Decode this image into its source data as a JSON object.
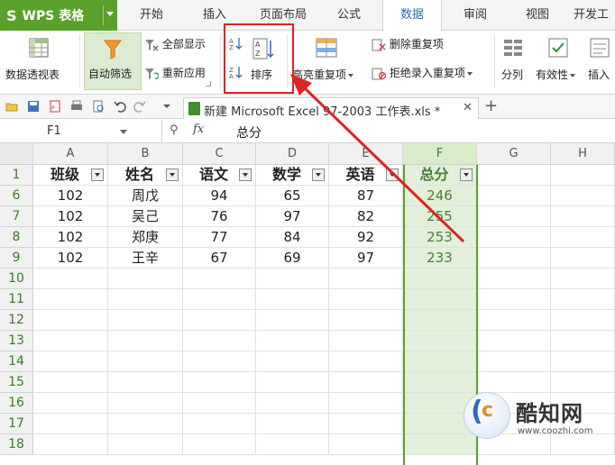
{
  "app": {
    "name": "WPS 表格",
    "colors": {
      "brand_green": "#5aa12c",
      "active_tab_text": "#2b6cc4",
      "highlight_red": "#e02222",
      "selected_col_fill": "#e2f0d9"
    }
  },
  "tabs": [
    {
      "label": "开始",
      "active": false
    },
    {
      "label": "插入",
      "active": false
    },
    {
      "label": "页面布局",
      "active": false
    },
    {
      "label": "公式",
      "active": false
    },
    {
      "label": "数据",
      "active": true
    },
    {
      "label": "审阅",
      "active": false
    },
    {
      "label": "视图",
      "active": false
    },
    {
      "label": "开发工",
      "active": false
    }
  ],
  "ribbon": {
    "pivot": "数据透视表",
    "autofilter": "自动筛选",
    "show_all": "全部显示",
    "reapply": "重新应用",
    "sort": "排序",
    "highlight_dup": "高亮重复项",
    "remove_dup": "删除重复项",
    "reject_dup": "拒绝录入重复项",
    "split": "分列",
    "validity": "有效性",
    "insert": "插入"
  },
  "document": {
    "tab_title": "新建 Microsoft Excel 97-2003 工作表.xls *"
  },
  "formula_bar": {
    "cell_ref": "F1",
    "fx": "fx",
    "content": "总分"
  },
  "grid": {
    "columns": [
      "A",
      "B",
      "C",
      "D",
      "E",
      "F",
      "G",
      "H"
    ],
    "selected_column": "F",
    "row_numbers": [
      "1",
      "6",
      "7",
      "8",
      "9",
      "10",
      "11",
      "12",
      "13",
      "14",
      "15",
      "16",
      "17",
      "18"
    ],
    "header": [
      "班级",
      "姓名",
      "语文",
      "数学",
      "英语",
      "总分"
    ],
    "rows": [
      [
        "102",
        "周戊",
        "94",
        "65",
        "87",
        "246"
      ],
      [
        "102",
        "吴己",
        "76",
        "97",
        "82",
        "255"
      ],
      [
        "102",
        "郑庚",
        "77",
        "84",
        "92",
        "253"
      ],
      [
        "102",
        "王辛",
        "67",
        "69",
        "97",
        "233"
      ]
    ]
  },
  "watermark": {
    "name": "酷知网",
    "url": "www.coozhi.com"
  }
}
